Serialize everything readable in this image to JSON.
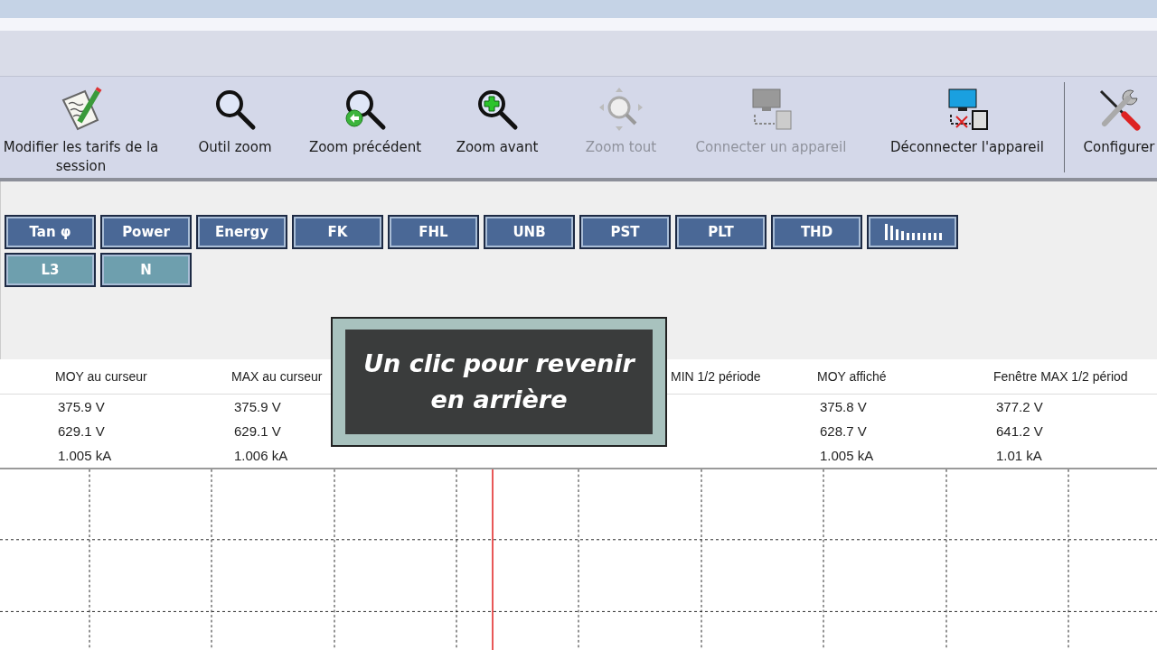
{
  "toolbar": {
    "items": [
      {
        "label": "Modifier les tarifs de la session",
        "kind": "edit",
        "disabled": false
      },
      {
        "label": "Outil zoom",
        "kind": "zoom",
        "disabled": false
      },
      {
        "label": "Zoom précédent",
        "kind": "zoom-back",
        "disabled": false
      },
      {
        "label": "Zoom avant",
        "kind": "zoom-in",
        "disabled": false
      },
      {
        "label": "Zoom tout",
        "kind": "zoom-all",
        "disabled": true
      },
      {
        "label": "Connecter un appareil",
        "kind": "connect",
        "disabled": true
      },
      {
        "label": "Déconnecter l'appareil",
        "kind": "disconnect",
        "disabled": false
      },
      {
        "label": "Configurer",
        "kind": "tools",
        "disabled": false,
        "separator_before": true
      }
    ]
  },
  "measure_buttons": [
    [
      {
        "label": "Tan φ",
        "kind": "text",
        "color": "#4a6896"
      },
      {
        "label": "Power",
        "kind": "text",
        "color": "#4a6896"
      },
      {
        "label": "Energy",
        "kind": "text",
        "color": "#4a6896"
      },
      {
        "label": "FK",
        "kind": "text",
        "color": "#4a6896"
      },
      {
        "label": "FHL",
        "kind": "text",
        "color": "#4a6896"
      },
      {
        "label": "UNB",
        "kind": "text",
        "color": "#4a6896"
      },
      {
        "label": "PST",
        "kind": "text",
        "color": "#4a6896"
      },
      {
        "label": "PLT",
        "kind": "text",
        "color": "#4a6896"
      },
      {
        "label": "THD",
        "kind": "text",
        "color": "#4a6896"
      },
      {
        "kind": "bars",
        "color": "#4a6896"
      }
    ],
    [
      {
        "label": "L3",
        "kind": "text",
        "color": "#6e9fae"
      },
      {
        "label": "N",
        "kind": "text",
        "color": "#6e9fae"
      }
    ]
  ],
  "table": {
    "columns": [
      null,
      "MOY au curseur",
      "MAX au curseur",
      null,
      "MIN 1/2 période",
      "MOY affiché",
      "Fenêtre MAX 1/2 périod"
    ],
    "rows": [
      [
        null,
        "375.9 V",
        "375.9 V",
        null,
        null,
        "375.8 V",
        "377.2 V"
      ],
      [
        null,
        "629.1 V",
        "629.1 V",
        null,
        null,
        "628.7 V",
        "641.2 V"
      ],
      [
        null,
        "1.005 kA",
        "1.006 kA",
        null,
        null,
        "1.005 kA",
        "1.01 kA"
      ]
    ]
  },
  "tooltip": {
    "text": "Un clic pour revenir en arrière"
  }
}
